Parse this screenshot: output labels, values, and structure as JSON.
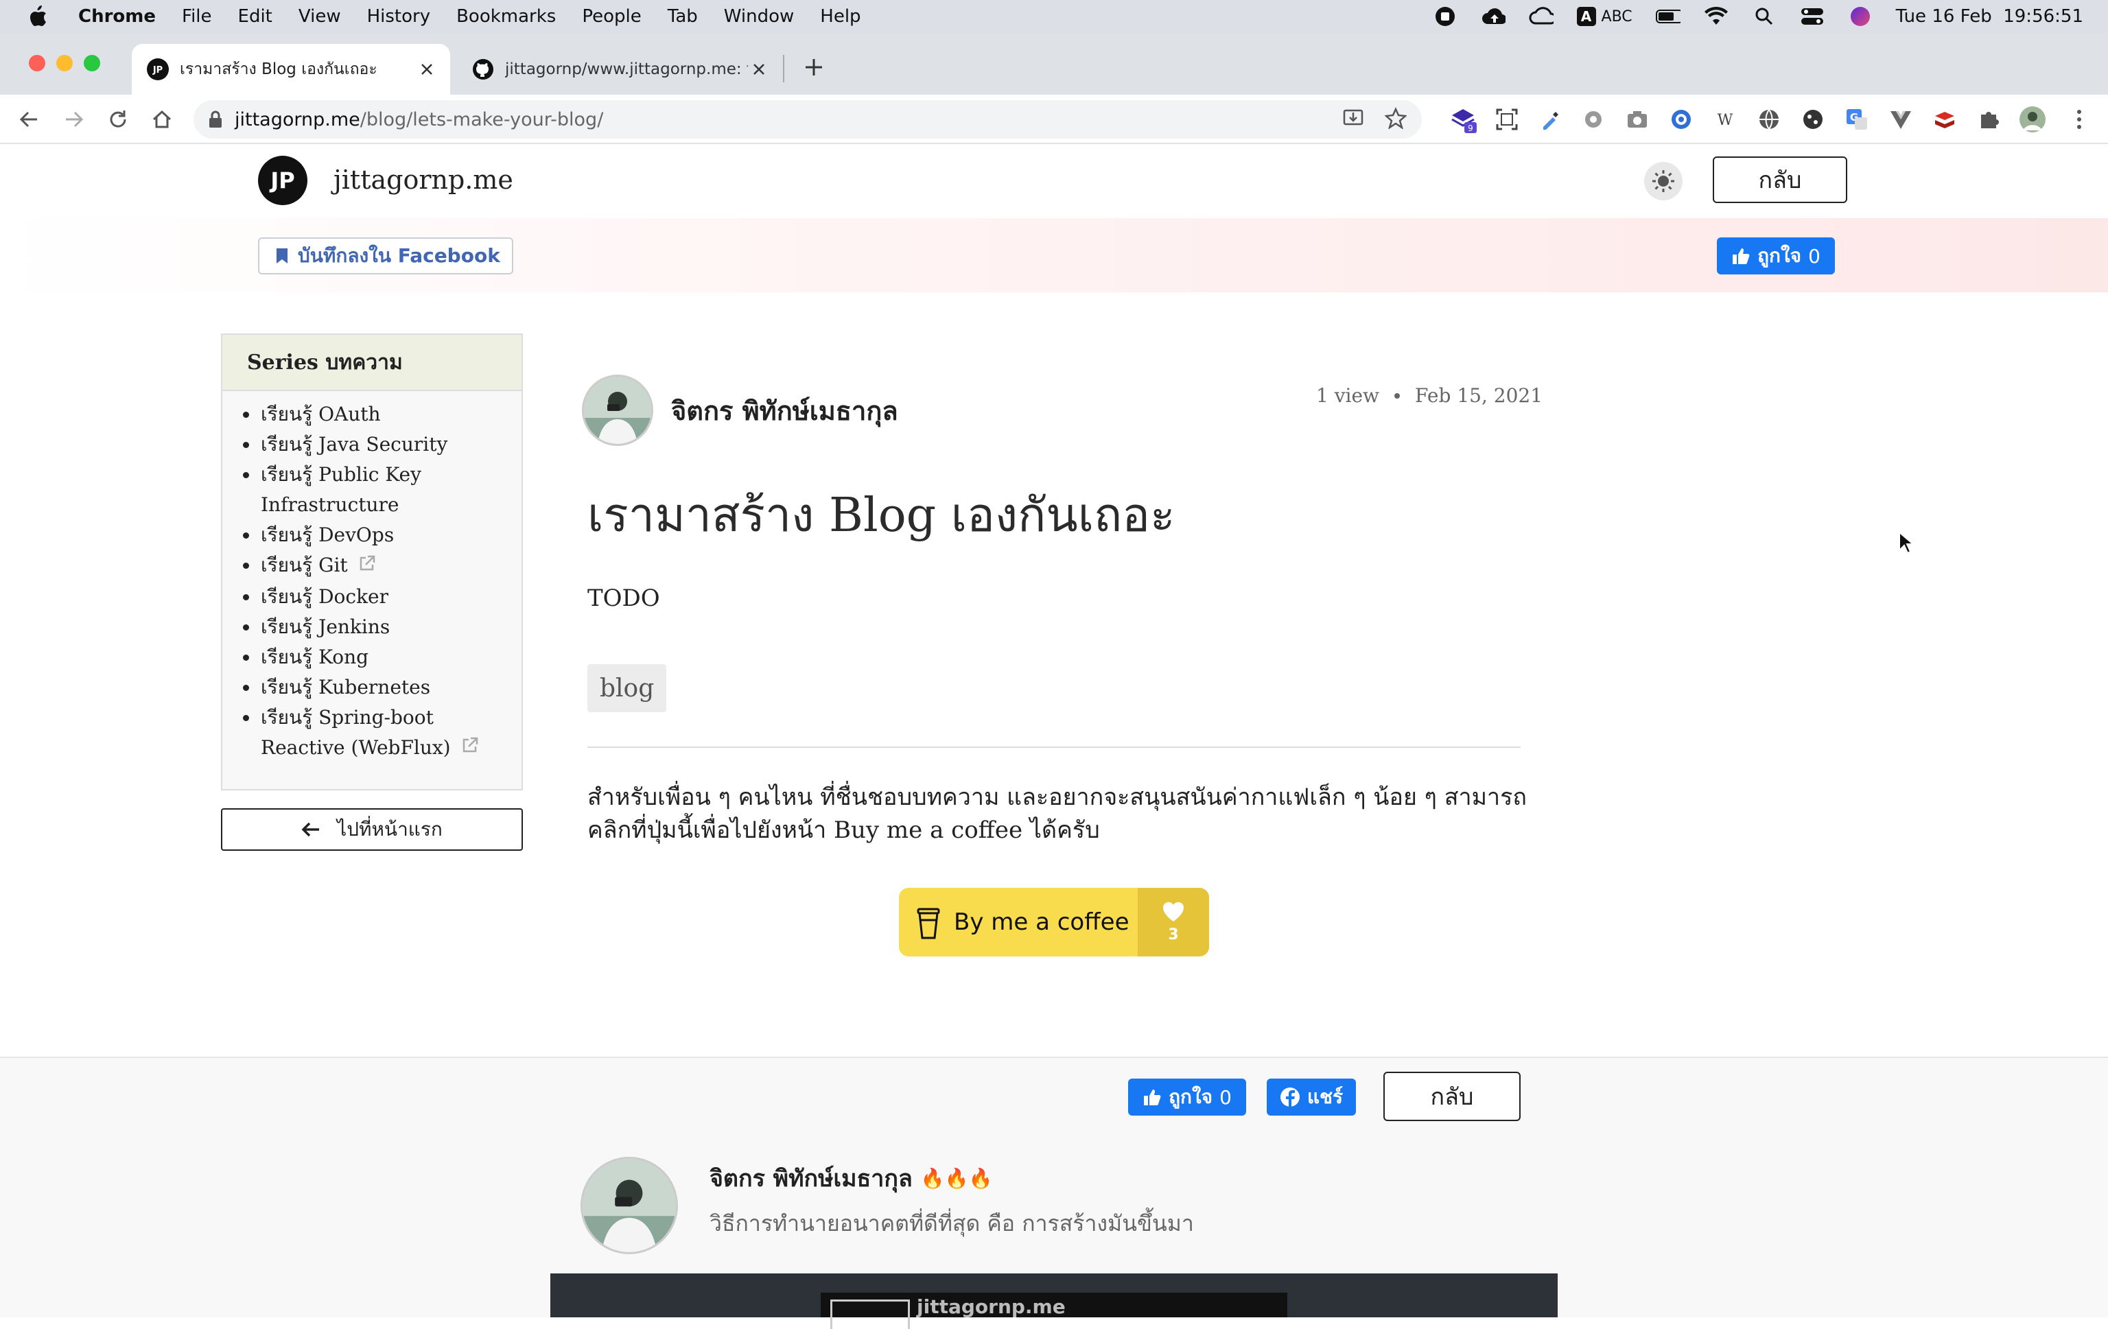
{
  "menubar": {
    "app": "Chrome",
    "items": [
      "File",
      "Edit",
      "View",
      "History",
      "Bookmarks",
      "People",
      "Tab",
      "Window",
      "Help"
    ],
    "input_source": "ABC",
    "clock": "Tue 16 Feb  19:56:51"
  },
  "tabs": [
    {
      "title": "เรามาสร้าง Blog เองกันเถอะ",
      "icon": "jp-favicon"
    },
    {
      "title": "jittagornp/www.jittagornp.me: t",
      "icon": "github-icon"
    }
  ],
  "toolbar": {
    "url_host": "jittagornp.me",
    "url_path": "/blog/lets-make-your-blog/",
    "extension_badge": "9"
  },
  "site": {
    "logo": "JP",
    "name": "jittagornp.me",
    "back_label": "กลับ"
  },
  "facebook": {
    "save_label": "บันทึกลงใน Facebook",
    "like_label": "ถูกใจ",
    "like_count": "0",
    "share_label": "แชร์"
  },
  "sidebar": {
    "heading": "Series บทความ",
    "items": [
      {
        "label": "เรียนรู้ OAuth",
        "external": false
      },
      {
        "label": "เรียนรู้ Java Security",
        "external": false
      },
      {
        "label": "เรียนรู้ Public Key Infrastructure",
        "external": false
      },
      {
        "label": "เรียนรู้ DevOps",
        "external": false
      },
      {
        "label": "เรียนรู้ Git",
        "external": true
      },
      {
        "label": "เรียนรู้ Docker",
        "external": false
      },
      {
        "label": "เรียนรู้ Jenkins",
        "external": false
      },
      {
        "label": "เรียนรู้ Kong",
        "external": false
      },
      {
        "label": "เรียนรู้ Kubernetes",
        "external": false
      },
      {
        "label": "เรียนรู้ Spring-boot Reactive (WebFlux)",
        "external": true
      }
    ],
    "home_button": "ไปที่หน้าแรก"
  },
  "article": {
    "author": "จิตกร พิทักษ์เมธากุล",
    "views": "1 view",
    "date": "Feb 15, 2021",
    "title": "เรามาสร้าง Blog เองกันเถอะ",
    "body": "TODO",
    "tag": "blog",
    "support_text": "สำหรับเพื่อน ๆ คนไหน ที่ชื่นชอบบทความ และอยากจะสนุนสนันค่ากาแฟเล็ก ๆ น้อย ๆ สามารถคลิกที่ปุ่มนี้เพื่อไปยังหน้า Buy me a coffee ได้ครับ",
    "coffee_label": "By me a coffee",
    "coffee_count": "3"
  },
  "author_footer": {
    "name": "จิตกร พิทักษ์เมธากุล",
    "fires": "🔥🔥🔥",
    "bio": "วิธีการทำนายอนาคตที่ดีที่สุด คือ การสร้างมันขึ้นมา",
    "partial_banner_text": "jittagornp.me"
  },
  "colors": {
    "facebook_blue": "#1877f2",
    "coffee_yellow": "#f9dc4e",
    "coffee_dark": "#e6c43a"
  }
}
